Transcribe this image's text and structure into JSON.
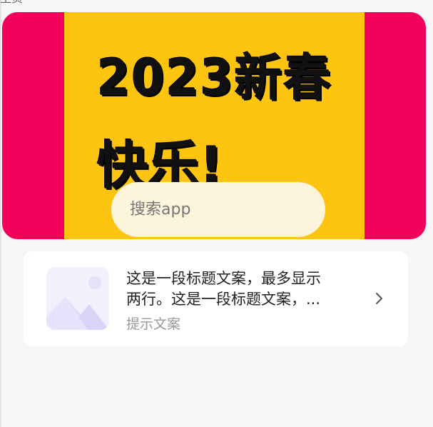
{
  "page": {
    "top_label": "主页"
  },
  "banner": {
    "line1": "2023新春",
    "line2": "快乐!",
    "colors": {
      "outer": "#f2005a",
      "inner": "#fec510",
      "text": "#111111"
    }
  },
  "search": {
    "placeholder": "搜索app"
  },
  "list": {
    "items": [
      {
        "title_line1": "这是一段标题文案，最多显示",
        "title_line2": "两行。这是一段标题文案，...",
        "hint": "提示文案",
        "thumb_icon": "image-placeholder-icon",
        "arrow_icon": "chevron-right-icon"
      }
    ]
  }
}
